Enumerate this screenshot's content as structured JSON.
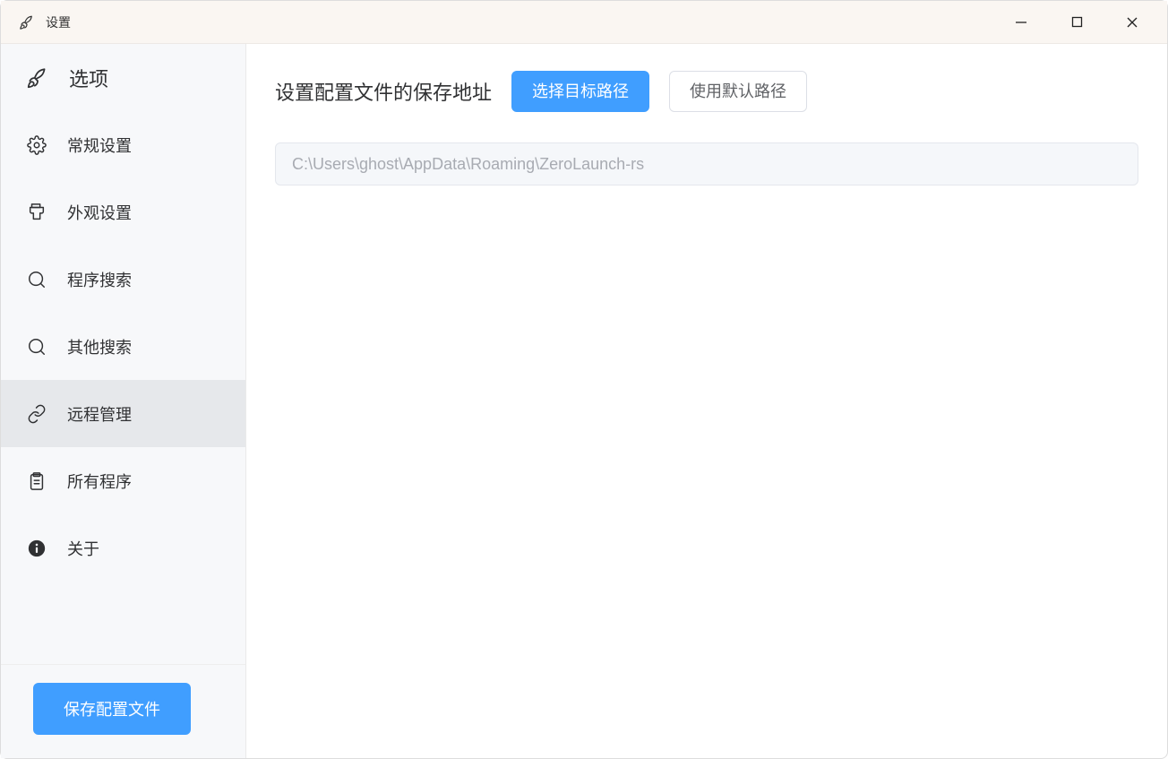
{
  "window": {
    "title": "设置"
  },
  "sidebar": {
    "items": [
      {
        "label": "选项",
        "icon": "rocket-icon",
        "header": true
      },
      {
        "label": "常规设置",
        "icon": "gear-icon"
      },
      {
        "label": "外观设置",
        "icon": "appearance-icon"
      },
      {
        "label": "程序搜索",
        "icon": "search-icon"
      },
      {
        "label": "其他搜索",
        "icon": "search-icon"
      },
      {
        "label": "远程管理",
        "icon": "link-icon",
        "selected": true
      },
      {
        "label": "所有程序",
        "icon": "clipboard-icon"
      },
      {
        "label": "关于",
        "icon": "info-icon"
      }
    ],
    "saveButton": "保存配置文件"
  },
  "main": {
    "sectionTitle": "设置配置文件的保存地址",
    "selectPathButton": "选择目标路径",
    "defaultPathButton": "使用默认路径",
    "pathValue": "C:\\Users\\ghost\\AppData\\Roaming\\ZeroLaunch-rs"
  }
}
